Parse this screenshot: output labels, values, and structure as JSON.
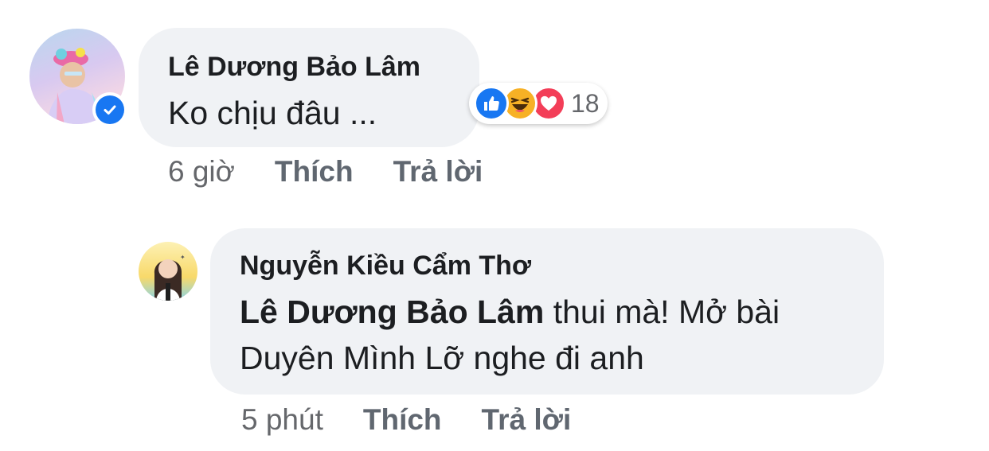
{
  "comment1": {
    "author": "Lê Dương Bảo Lâm",
    "text": "Ko chịu đâu ...",
    "reaction_count": "18",
    "reactions": [
      "like-icon",
      "haha-icon",
      "love-icon"
    ],
    "time": "6 giờ",
    "like_label": "Thích",
    "reply_label": "Trả lời",
    "verified": true
  },
  "comment2": {
    "author": "Nguyễn Kiều Cẩm Thơ",
    "mention": "Lê Dương Bảo Lâm",
    "text_line1_rest": " thui mà! Mở bài",
    "text_line2": "Duyên Mình Lỡ nghe đi anh",
    "time": "5 phút",
    "like_label": "Thích",
    "reply_label": "Trả lời"
  },
  "colors": {
    "bubble": "#f0f2f5",
    "like_blue": "#1877f2",
    "love_red": "#f33e58",
    "haha_yellow": "#f7b125"
  }
}
